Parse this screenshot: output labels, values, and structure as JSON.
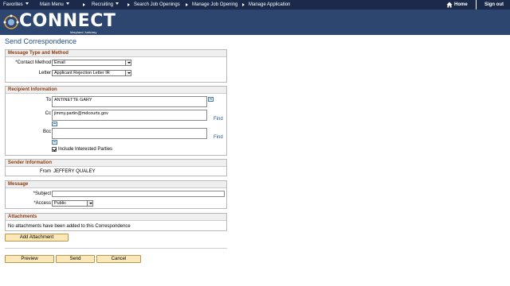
{
  "nav": {
    "favorites": "Favorites",
    "main_menu": "Main Menu",
    "recruiting": "Recruiting",
    "search_job_openings": "Search Job Openings",
    "manage_job_opening": "Manage Job Opening",
    "manage_application": "Manage Application",
    "home": "Home",
    "sign_out": "Sign out"
  },
  "banner": {
    "title": "CONNECT",
    "subtitle": "Maryland Judiciary"
  },
  "page_title": "Send Correspondence",
  "message_type": {
    "heading": "Message Type and Method",
    "contact_method_label": "*Contact Method",
    "contact_method_value": "Email",
    "letter_label": "Letter",
    "letter_value": "Applicant Rejection Letter IR"
  },
  "recipient": {
    "heading": "Recipient Information",
    "to_label": "To",
    "to_value": "ANTINETTE GARY",
    "cc_label": "Cc",
    "cc_value": "jimmy.partin@mdcourts.gov",
    "bcc_label": "Bcc",
    "bcc_value": "",
    "find_label_cc": "Find",
    "find_label_bcc": "Find",
    "include_label": "Include Interested Parties"
  },
  "sender": {
    "heading": "Sender Information",
    "from_label": "From",
    "from_value": "JEFFERY QUALEY"
  },
  "message": {
    "heading": "Message",
    "subject_label": "*Subject",
    "subject_value": "",
    "access_label": "*Access",
    "access_value": "Public"
  },
  "attachments": {
    "heading": "Attachments",
    "empty_text": "No attachments have been added to this Correspondence",
    "add_button": "Add Attachment"
  },
  "actions": {
    "preview": "Preview",
    "send": "Send",
    "cancel": "Cancel"
  }
}
